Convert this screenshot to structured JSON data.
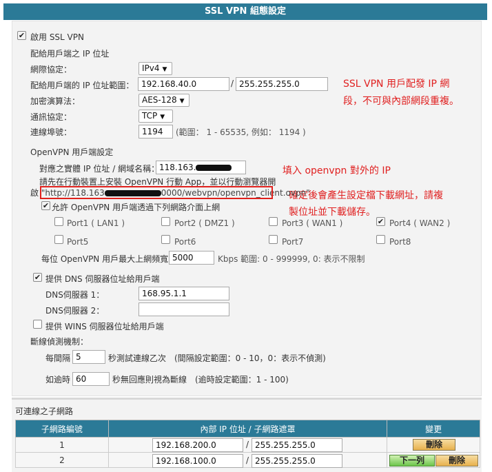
{
  "title": "SSL VPN 組態設定",
  "enable_ssl_vpn": {
    "label": "啟用 SSL VPN",
    "checked": true
  },
  "client_ip_section": "配給用戶端之 IP 位址",
  "protocol": {
    "label": "網際協定：",
    "value": "IPv4"
  },
  "ip_range": {
    "label": "配給用戶端的 IP 位址範圍：",
    "ip": "192.168.40.0",
    "sep": "/",
    "mask": "255.255.255.0"
  },
  "encryption": {
    "label": "加密演算法：",
    "value": "AES-128"
  },
  "transport": {
    "label": "通訊協定：",
    "value": "TCP"
  },
  "port": {
    "label": "連線埠號：",
    "value": "1194",
    "hint": "(範圍： 1 - 65535, 例如： 1194 )"
  },
  "annotations": {
    "red_note_line1": "SSL VPN 用戶配發 IP 網",
    "red_note_line2": "段，不可與內部網段重複。",
    "openvpn_ip_note": "填入 openvpn 對外的 IP",
    "download_note_line1": "確定後會產生設定檔下載網址，請複",
    "download_note_line2": "製位址並下載儲存。"
  },
  "openvpn": {
    "section": "OpenVPN 用戶端設定",
    "host_label": "對應之實體 IP 位址 / 網域名稱：",
    "host_value": "118.163.",
    "instruction_line1": "請先在行動裝置上安裝 OpenVPN 行動 App，並以行動瀏覽器開",
    "instruction_prefix": "啟 ",
    "url_start": "\"http://118.163",
    "url_end": "0000/webvpn/openvpn_client.ovpn\"",
    "allow_label": "允許 OpenVPN 用戶端透過下列網路介面上網",
    "allow_checked": true,
    "ports": [
      {
        "label": "Port1 ( LAN1 )",
        "checked": false
      },
      {
        "label": "Port2 ( DMZ1 )",
        "checked": false
      },
      {
        "label": "Port3 ( WAN1 )",
        "checked": false
      },
      {
        "label": "Port4 ( WAN2 )",
        "checked": true
      },
      {
        "label": "Port5",
        "checked": false
      },
      {
        "label": "Port6",
        "checked": false
      },
      {
        "label": "Port7",
        "checked": false
      },
      {
        "label": "Port8",
        "checked": false
      }
    ],
    "bandwidth_label": "每位 OpenVPN 用戶最大上網頻寬：",
    "bandwidth_value": "5000",
    "bandwidth_hint": "Kbps 範圍: 0 - 999999, 0: 表示不限制"
  },
  "dns": {
    "label": "提供 DNS 伺服器位址給用戶端",
    "checked": true,
    "server1_label": "DNS伺服器 1：",
    "server1_value": "168.95.1.1",
    "server2_label": "DNS伺服器 2：",
    "server2_value": ""
  },
  "wins": {
    "label": "提供 WINS 伺服器位址給用戶端",
    "checked": false
  },
  "disconnect": {
    "section": "斷線偵測機制：",
    "interval_prefix": "每間隔",
    "interval_value": "5",
    "interval_suffix": "秒測試連線乙次　(間隔設定範圍：0 - 10，0：表示不偵測)",
    "timeout_prefix": "如逾時",
    "timeout_value": "60",
    "timeout_suffix": "秒無回應則視為斷線　(逾時設定範圍：1 - 100)"
  },
  "subnets": {
    "section": "可連線之子網路",
    "headers": [
      "子網路編號",
      "內部 IP 位址 / 子網路遮罩",
      "變更"
    ],
    "rows": [
      {
        "num": "1",
        "ip": "192.168.200.0",
        "mask": "255.255.255.0",
        "sep": "/",
        "delete_label": "刪除"
      },
      {
        "num": "2",
        "ip": "192.168.100.0",
        "mask": "255.255.255.0",
        "sep": "/",
        "next_label": "下一列",
        "delete_label": "刪除"
      }
    ]
  }
}
